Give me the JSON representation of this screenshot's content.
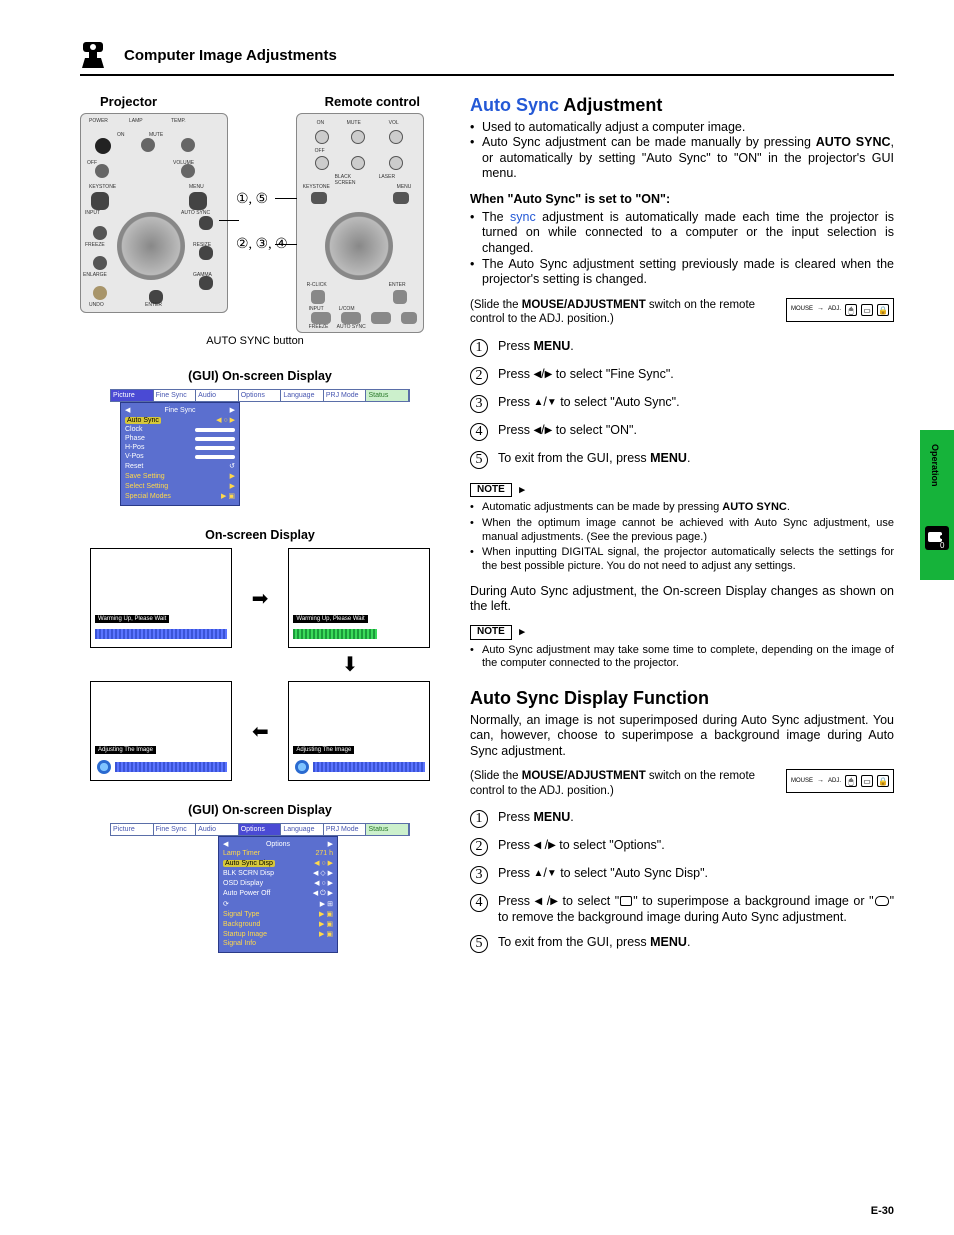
{
  "header": {
    "title": "Computer Image Adjustments"
  },
  "left": {
    "projector_label": "Projector",
    "remote_label": "Remote control",
    "callout_a": "①, ⑤",
    "callout_b": "②, ③, ④",
    "autosync_btn_label": "AUTO SYNC button",
    "gui_osd_label_1": "(GUI) On-screen Display",
    "osd_label": "On-screen Display",
    "gui_osd_label_2": "(GUI) On-screen Display",
    "osd_top_text": "Warming Up, Please Wait",
    "osd_bottom_text": "Adjusting The Image",
    "menu_tabs": [
      "Picture",
      "Fine Sync",
      "Audio",
      "Options",
      "Language",
      "PRJ Mode",
      "Status"
    ],
    "fine_sync_rows": [
      "Fine Sync",
      "Auto Sync",
      "Clock",
      "Phase",
      "H-Pos",
      "V-Pos",
      "Reset",
      "Save Setting",
      "Select Setting",
      "Special Modes"
    ],
    "options_title": "Options",
    "options_rows": [
      "Lamp Timer",
      "Auto Sync Disp",
      "BLK SCRN Disp",
      "OSD Display",
      "Auto Power Off",
      "",
      "Signal Type",
      "Background",
      "Startup Image",
      "Signal Info"
    ],
    "lamp_val": "271 h",
    "projector_top_labels": [
      "POWER",
      "LAMP",
      "TEMP."
    ],
    "projector_btn_labels": [
      "ON",
      "MUTE",
      "OFF",
      "VOLUME",
      "KEYSTONE",
      "MENU",
      "INPUT",
      "AUTO SYNC",
      "FREEZE",
      "RESIZE",
      "ENLARGE",
      "GAMMA",
      "UNDO",
      "ENTER"
    ],
    "remote_btn_labels": [
      "ON",
      "MUTE",
      "VOL",
      "OFF",
      "BLACK SCREEN",
      "LASER",
      "KEYSTONE",
      "MENU",
      "R-CLICK",
      "ENTER",
      "INPUT",
      "L/COM",
      "FREEZE",
      "AUTO SYNC"
    ]
  },
  "right": {
    "h2_a_link": "Auto Sync",
    "h2_a_rest": " Adjustment",
    "intro_bullets": [
      "Used to automatically adjust a computer image.",
      "Auto Sync adjustment can be made manually by pressing AUTO SYNC, or automatically by setting \"Auto Sync\" to \"ON\" in the projector's GUI menu."
    ],
    "when_on_head": "When \"Auto Sync\" is set to \"ON\":",
    "when_on_bullets_pre": "The ",
    "when_on_sync_word": "sync",
    "when_on_bullets_post": " adjustment is automatically made each time the projector is turned on while connected to a computer or the input selection is changed.",
    "when_on_b2": "The Auto Sync adjustment setting previously made is cleared when the projector's setting is changed.",
    "slide_text_1": "(Slide the ",
    "slide_bold": "MOUSE/ADJUSTMENT",
    "slide_text_2": " switch on the remote control to the ADJ. position.)",
    "switch_labels": {
      "mouse": "MOUSE",
      "adj": "ADJ."
    },
    "steps_a": [
      "Press MENU.",
      "Press ◀/▶ to select \"Fine Sync\".",
      "Press ▲/▼ to select \"Auto Sync\".",
      "Press ◀/▶ to select \"ON\".",
      "To exit from the GUI, press MENU."
    ],
    "note_label": "NOTE",
    "notes_a": [
      "Automatic adjustments can be made by pressing AUTO SYNC.",
      "When the optimum image cannot be achieved with Auto Sync adjustment, use manual adjustments. (See the previous page.)",
      "When inputting DIGITAL signal, the projector automatically selects the settings for the best possible picture. You do not need to adjust any settings."
    ],
    "mid_para": "During Auto Sync adjustment, the On-screen Display changes as shown on the left.",
    "notes_b": [
      "Auto Sync adjustment may take some time to complete, depending on the image of the computer connected to the projector."
    ],
    "h2_b": "Auto Sync Display Function",
    "para_b": "Normally, an image is not superimposed during Auto Sync adjustment. You can, however, choose to superimpose a background image during Auto Sync adjustment.",
    "steps_b": [
      "Press MENU.",
      "Press ◀ /▶ to select \"Options\".",
      "Press ▲/▼ to select \"Auto Sync Disp\".",
      "Press ◀ /▶ to select \"□\" to superimpose a background image or \"☁\" to remove the background image during Auto Sync adjustment.",
      "To exit from the GUI, press MENU."
    ]
  },
  "side": {
    "label": "Operation"
  },
  "page_number": "E-30"
}
